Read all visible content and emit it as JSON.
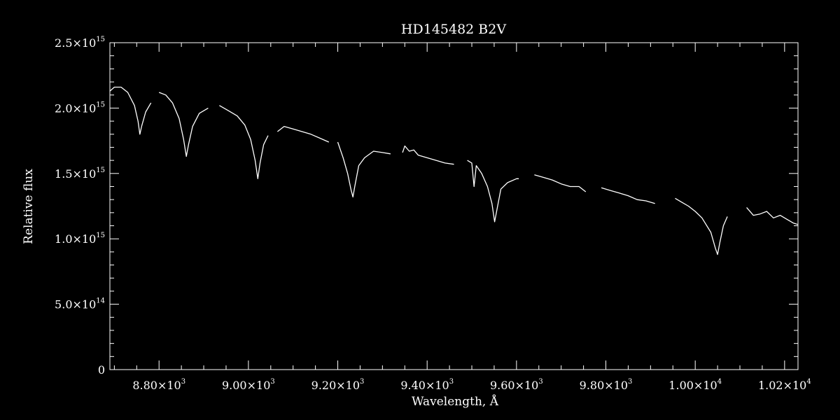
{
  "chart_data": {
    "type": "line",
    "title": "HD145482   B2V",
    "xlabel": "Wavelength, Å",
    "ylabel": "Relative flux",
    "xlim": [
      8690,
      10230
    ],
    "ylim": [
      0,
      2500000000000000.0
    ],
    "grid": false,
    "background": "#000000",
    "line_color": "#ffffff",
    "x_ticks": [
      {
        "value": 8800,
        "mant": "8.80×10",
        "exp": "3"
      },
      {
        "value": 9000,
        "mant": "9.00×10",
        "exp": "3"
      },
      {
        "value": 9200,
        "mant": "9.20×10",
        "exp": "3"
      },
      {
        "value": 9400,
        "mant": "9.40×10",
        "exp": "3"
      },
      {
        "value": 9600,
        "mant": "9.60×10",
        "exp": "3"
      },
      {
        "value": 9800,
        "mant": "9.80×10",
        "exp": "3"
      },
      {
        "value": 10000,
        "mant": "1.00×10",
        "exp": "4"
      },
      {
        "value": 10200,
        "mant": "1.02×10",
        "exp": "4"
      }
    ],
    "y_ticks": [
      {
        "value": 0,
        "mant": "0",
        "exp": ""
      },
      {
        "value": 500000000000000.0,
        "mant": "5.0×10",
        "exp": "14"
      },
      {
        "value": 1000000000000000.0,
        "mant": "1.0×10",
        "exp": "15"
      },
      {
        "value": 1500000000000000.0,
        "mant": "1.5×10",
        "exp": "15"
      },
      {
        "value": 2000000000000000.0,
        "mant": "2.0×10",
        "exp": "15"
      },
      {
        "value": 2500000000000000.0,
        "mant": "2.5×10",
        "exp": "15"
      }
    ],
    "series": [
      {
        "segments": [
          [
            [
              8690,
              2130000000000000.0
            ],
            [
              8700,
              2160000000000000.0
            ],
            [
              8715,
              2160000000000000.0
            ],
            [
              8730,
              2120000000000000.0
            ],
            [
              8745,
              2020000000000000.0
            ],
            [
              8753,
              1900000000000000.0
            ],
            [
              8757,
              1800000000000000.0
            ],
            [
              8761,
              1860000000000000.0
            ],
            [
              8770,
              1970000000000000.0
            ],
            [
              8782,
              2040000000000000.0
            ]
          ],
          [
            [
              8800,
              2120000000000000.0
            ],
            [
              8815,
              2100000000000000.0
            ],
            [
              8830,
              2040000000000000.0
            ],
            [
              8845,
              1920000000000000.0
            ],
            [
              8855,
              1760000000000000.0
            ],
            [
              8861,
              1630000000000000.0
            ],
            [
              8866,
              1720000000000000.0
            ],
            [
              8875,
              1860000000000000.0
            ],
            [
              8890,
              1960000000000000.0
            ],
            [
              8910,
              2000000000000000.0
            ]
          ],
          [
            [
              8935,
              2020000000000000.0
            ],
            [
              8955,
              1980000000000000.0
            ],
            [
              8975,
              1940000000000000.0
            ],
            [
              8992,
              1870000000000000.0
            ],
            [
              9005,
              1760000000000000.0
            ],
            [
              9015,
              1600000000000000.0
            ],
            [
              9021,
              1460000000000000.0
            ],
            [
              9026,
              1580000000000000.0
            ],
            [
              9034,
              1720000000000000.0
            ],
            [
              9044,
              1790000000000000.0
            ]
          ],
          [
            [
              9065,
              1820000000000000.0
            ],
            [
              9080,
              1860000000000000.0
            ],
            [
              9100,
              1840000000000000.0
            ],
            [
              9120,
              1820000000000000.0
            ],
            [
              9140,
              1800000000000000.0
            ],
            [
              9160,
              1770000000000000.0
            ],
            [
              9180,
              1740000000000000.0
            ]
          ],
          [
            [
              9200,
              1740000000000000.0
            ],
            [
              9212,
              1620000000000000.0
            ],
            [
              9222,
              1500000000000000.0
            ],
            [
              9230,
              1370000000000000.0
            ],
            [
              9234,
              1320000000000000.0
            ],
            [
              9238,
              1400000000000000.0
            ],
            [
              9247,
              1560000000000000.0
            ],
            [
              9260,
              1620000000000000.0
            ],
            [
              9280,
              1670000000000000.0
            ],
            [
              9300,
              1660000000000000.0
            ],
            [
              9318,
              1650000000000000.0
            ]
          ],
          [
            [
              9345,
              1660000000000000.0
            ],
            [
              9350,
              1710000000000000.0
            ],
            [
              9360,
              1670000000000000.0
            ],
            [
              9370,
              1680000000000000.0
            ],
            [
              9380,
              1640000000000000.0
            ],
            [
              9400,
              1620000000000000.0
            ],
            [
              9420,
              1600000000000000.0
            ],
            [
              9440,
              1580000000000000.0
            ],
            [
              9460,
              1570000000000000.0
            ]
          ],
          [
            [
              9490,
              1600000000000000.0
            ],
            [
              9500,
              1580000000000000.0
            ],
            [
              9505,
              1400000000000000.0
            ],
            [
              9510,
              1560000000000000.0
            ],
            [
              9522,
              1500000000000000.0
            ],
            [
              9535,
              1400000000000000.0
            ],
            [
              9545,
              1270000000000000.0
            ],
            [
              9551,
              1130000000000000.0
            ],
            [
              9556,
              1220000000000000.0
            ],
            [
              9565,
              1380000000000000.0
            ],
            [
              9580,
              1430000000000000.0
            ],
            [
              9600,
              1460000000000000.0
            ],
            [
              9605,
              1460000000000000.0
            ]
          ],
          [
            [
              9640,
              1490000000000000.0
            ],
            [
              9660,
              1470000000000000.0
            ],
            [
              9680,
              1450000000000000.0
            ],
            [
              9700,
              1420000000000000.0
            ],
            [
              9720,
              1400000000000000.0
            ],
            [
              9740,
              1400000000000000.0
            ],
            [
              9755,
              1360000000000000.0
            ]
          ],
          [
            [
              9790,
              1390000000000000.0
            ],
            [
              9810,
              1370000000000000.0
            ],
            [
              9830,
              1350000000000000.0
            ],
            [
              9850,
              1330000000000000.0
            ],
            [
              9870,
              1300000000000000.0
            ],
            [
              9890,
              1290000000000000.0
            ],
            [
              9910,
              1270000000000000.0
            ]
          ],
          [
            [
              9955,
              1310000000000000.0
            ],
            [
              9970,
              1280000000000000.0
            ],
            [
              9985,
              1250000000000000.0
            ],
            [
              10000,
              1210000000000000.0
            ],
            [
              10015,
              1160000000000000.0
            ],
            [
              10035,
              1050000000000000.0
            ],
            [
              10045,
              930000000000000.0
            ],
            [
              10050,
              880000000000000.0
            ],
            [
              10055,
              970000000000000.0
            ],
            [
              10063,
              1100000000000000.0
            ],
            [
              10072,
              1170000000000000.0
            ]
          ],
          [
            [
              10115,
              1240000000000000.0
            ],
            [
              10130,
              1180000000000000.0
            ],
            [
              10145,
              1190000000000000.0
            ],
            [
              10160,
              1210000000000000.0
            ],
            [
              10175,
              1160000000000000.0
            ],
            [
              10190,
              1180000000000000.0
            ],
            [
              10205,
              1150000000000000.0
            ],
            [
              10220,
              1120000000000000.0
            ],
            [
              10230,
              1110000000000000.0
            ]
          ]
        ]
      }
    ]
  }
}
